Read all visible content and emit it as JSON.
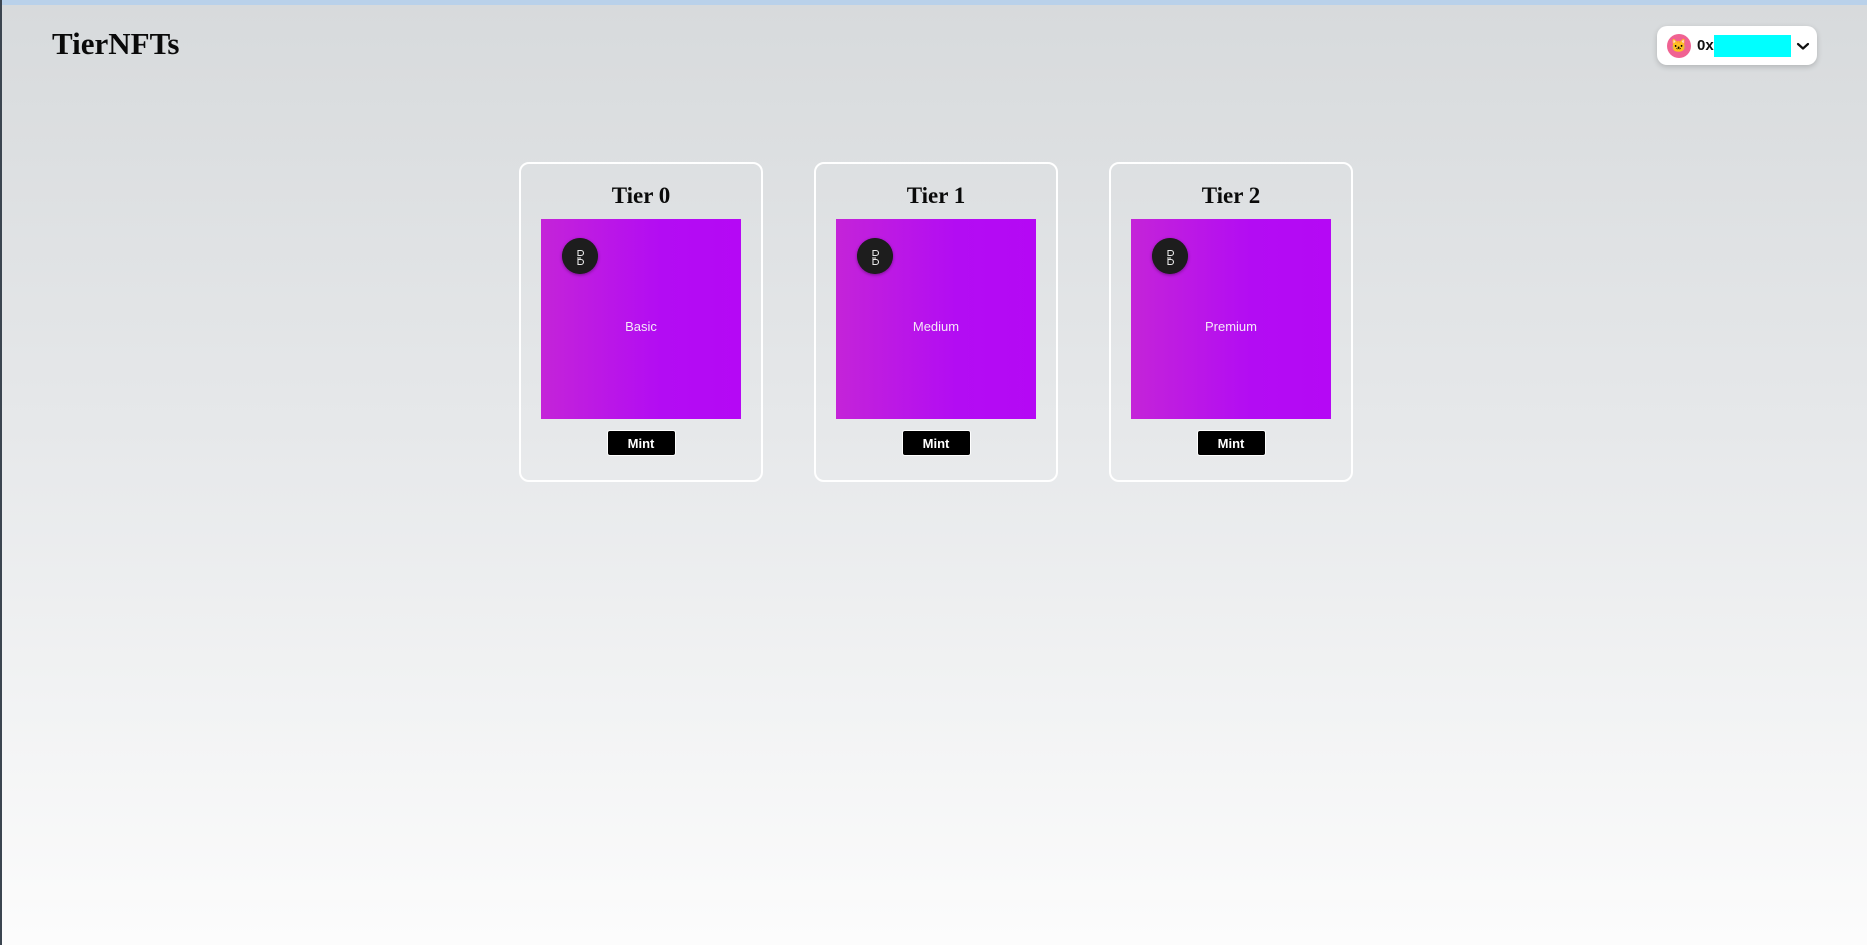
{
  "header": {
    "brand": "TierNFTs",
    "account": {
      "prefix": "0x",
      "avatar_icon": "cat-face-icon",
      "dropdown_icon": "chevron-down-icon"
    }
  },
  "tiers": [
    {
      "title": "Tier 0",
      "image_label": "Basic",
      "button_label": "Mint"
    },
    {
      "title": "Tier 1",
      "image_label": "Medium",
      "button_label": "Mint"
    },
    {
      "title": "Tier 2",
      "image_label": "Premium",
      "button_label": "Mint"
    }
  ],
  "colors": {
    "nft_gradient_start": "#c424d8",
    "nft_gradient_end": "#b508f5",
    "mint_button_bg": "#000000",
    "account_redaction": "#00ffff"
  }
}
